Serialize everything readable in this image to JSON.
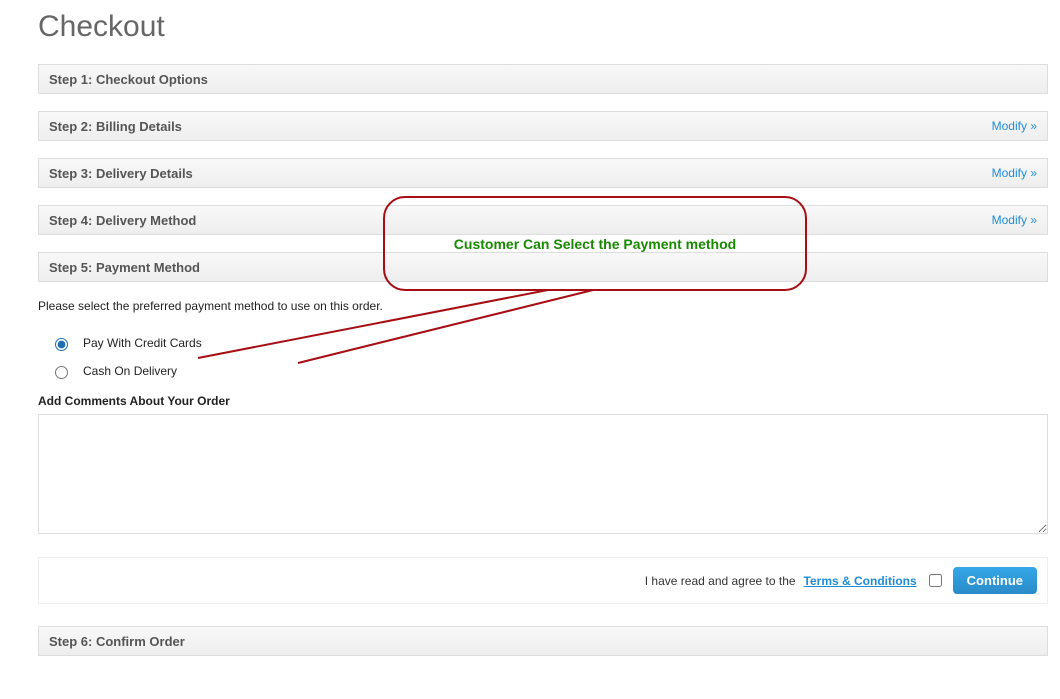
{
  "page_title": "Checkout",
  "steps": [
    {
      "label": "Step 1: Checkout Options",
      "modify": null
    },
    {
      "label": "Step 2: Billing Details",
      "modify": "Modify »"
    },
    {
      "label": "Step 3: Delivery Details",
      "modify": "Modify »"
    },
    {
      "label": "Step 4: Delivery Method",
      "modify": "Modify »"
    },
    {
      "label": "Step 5: Payment Method",
      "modify": null
    },
    {
      "label": "Step 6: Confirm Order",
      "modify": null
    }
  ],
  "payment": {
    "prompt": "Please select the preferred payment method to use on this order.",
    "options": [
      {
        "label": "Pay With Credit Cards",
        "selected": true
      },
      {
        "label": "Cash On Delivery",
        "selected": false
      }
    ],
    "comments_label": "Add Comments About Your Order",
    "agree_prefix": "I have read and agree to the ",
    "terms_link_text": "Terms & Conditions",
    "continue_label": "Continue"
  },
  "annotation": {
    "text": "Customer Can Select the Payment method"
  }
}
